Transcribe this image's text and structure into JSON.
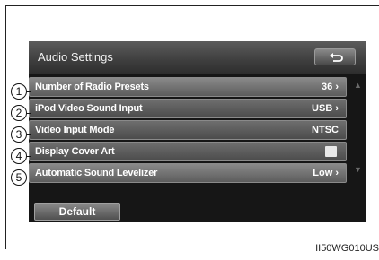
{
  "header": {
    "title": "Audio Settings",
    "back_icon": "return-arrow-icon"
  },
  "rows": [
    {
      "number": "1",
      "label": "Number of Radio Presets",
      "value": "36 ›"
    },
    {
      "number": "2",
      "label": "iPod Video Sound Input",
      "value": "USB ›"
    },
    {
      "number": "3",
      "label": "Video Input Mode",
      "value": "NTSC"
    },
    {
      "number": "4",
      "label": "Display Cover Art",
      "value": "",
      "checkbox": true
    },
    {
      "number": "5",
      "label": "Automatic Sound Levelizer",
      "value": "Low ›"
    }
  ],
  "default_button": "Default",
  "figure_code": "II50WG010US"
}
